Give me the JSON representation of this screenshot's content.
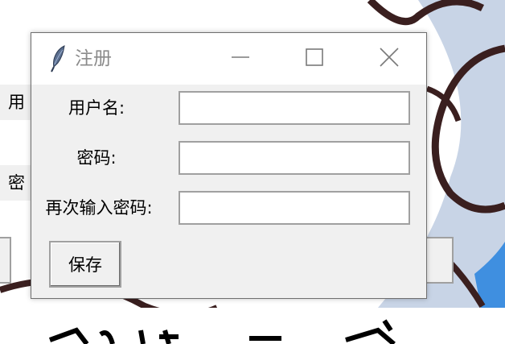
{
  "background_window": {
    "label_fragment_1": "用户",
    "label_fragment_2": "密码"
  },
  "dialog": {
    "title": "注册",
    "title_icon": "feather-icon",
    "controls": {
      "minimize_icon": "minimize-icon",
      "maximize_icon": "maximize-icon",
      "close_icon": "close-icon"
    },
    "fields": {
      "username_label": "用户名:",
      "username_value": "",
      "password_label": "密码:",
      "password_value": "",
      "confirm_label": "再次输入密码:",
      "confirm_value": ""
    },
    "save_label": "保存"
  },
  "colors": {
    "dialog_bg": "#f0f0f0",
    "titlebar_bg": "#ffffff",
    "title_text": "#8b8b8b",
    "input_border": "#a0a0a0",
    "bg_stroke": "#3a1f1f",
    "bg_fill": "#c8d4e6",
    "bg_accent": "#3f8fe0"
  }
}
